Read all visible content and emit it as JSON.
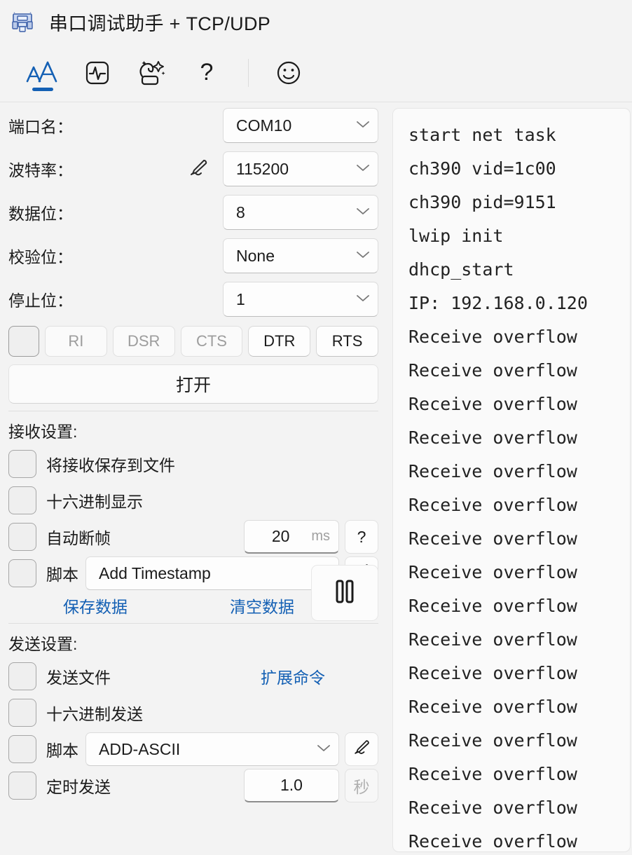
{
  "window": {
    "icon": "serial-port-icon",
    "title": "串口调试助手 + TCP/UDP"
  },
  "toolbar": {
    "items": [
      {
        "name": "font-size-icon",
        "label": "AA",
        "active": true
      },
      {
        "name": "waveform-icon",
        "label": "Waveform",
        "active": false
      },
      {
        "name": "magic-box-icon",
        "label": "Magic Box",
        "active": false
      },
      {
        "name": "help-icon",
        "label": "?",
        "active": false
      },
      {
        "name": "smiley-icon",
        "label": "Smiley",
        "active": false
      }
    ]
  },
  "serial": {
    "fields": [
      {
        "label": "端口名：",
        "value": "COM10",
        "pen": false
      },
      {
        "label": "波特率：",
        "value": "115200",
        "pen": true
      },
      {
        "label": "数据位：",
        "value": "8",
        "pen": false
      },
      {
        "label": "校验位：",
        "value": "None",
        "pen": false
      },
      {
        "label": "停止位：",
        "value": "1",
        "pen": false
      }
    ],
    "signals": [
      {
        "label": "RI",
        "enabled": false
      },
      {
        "label": "DSR",
        "enabled": false
      },
      {
        "label": "CTS",
        "enabled": false
      },
      {
        "label": "DTR",
        "enabled": true
      },
      {
        "label": "RTS",
        "enabled": true
      }
    ],
    "open_button": "打开"
  },
  "receive": {
    "title": "接收设置:",
    "save_to_file": "将接收保存到文件",
    "hex_display": "十六进制显示",
    "auto_break_frame": "自动断帧",
    "break_value": "20",
    "break_unit": "ms",
    "help_button": "?",
    "script_label": "脚本",
    "script_value": "Add Timestamp",
    "save_data_link": "保存数据",
    "clear_data_link": "清空数据",
    "pause_button": "pause-icon",
    "edit_button": "pen-icon"
  },
  "send": {
    "title": "发送设置:",
    "send_file": "发送文件",
    "hex_send": "十六进制发送",
    "script_label": "脚本",
    "script_value": "ADD-ASCII",
    "timed_send": "定时发送",
    "interval_value": "1.0",
    "interval_unit": "秒",
    "ext_cmd_link": "扩展命令",
    "edit_button": "pen-icon"
  },
  "terminal": {
    "lines": [
      "start net task",
      "ch390 vid=1c00",
      "ch390 pid=9151",
      "lwip init",
      "dhcp_start",
      "IP: 192.168.0.120",
      "Receive overflow",
      "Receive overflow",
      "Receive overflow",
      "Receive overflow",
      "Receive overflow",
      "Receive overflow",
      "Receive overflow",
      "Receive overflow",
      "Receive overflow",
      "Receive overflow",
      "Receive overflow",
      "Receive overflow",
      "Receive overflow",
      "Receive overflow",
      "Receive overflow",
      "Receive overflow"
    ]
  },
  "colors": {
    "accent": "#1460b4",
    "background": "#f3f3f3",
    "panel": "#fafafa",
    "text": "#1b1b1b",
    "muted": "#9d9d9d"
  }
}
